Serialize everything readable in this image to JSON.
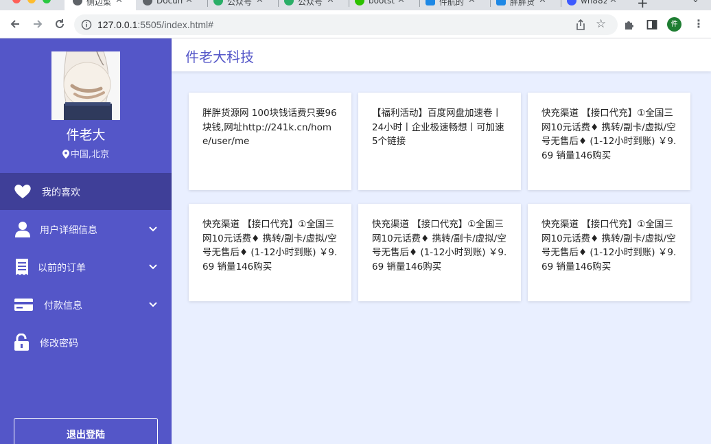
{
  "browser": {
    "tabs": [
      {
        "title": "侧边菜",
        "active": true,
        "favicon_color": "#5f6368"
      },
      {
        "title": "Docum",
        "active": false,
        "favicon_color": "#5f6368"
      },
      {
        "title": "公众号",
        "active": false,
        "favicon_color": "#2aae67"
      },
      {
        "title": "公众号",
        "active": false,
        "favicon_color": "#2aae67"
      },
      {
        "title": "bootst",
        "active": false,
        "favicon_color": "#2dc100"
      },
      {
        "title": "件航的",
        "active": false,
        "favicon_color": "#1e88e5"
      },
      {
        "title": "胖胖货",
        "active": false,
        "favicon_color": "#1e88e5"
      },
      {
        "title": "wh882",
        "active": false,
        "favicon_color": "#3d5afe"
      }
    ],
    "tab_close": "✕",
    "new_tab": "+",
    "url_host": "127.0.0.1",
    "url_rest": ":5505/index.html#",
    "profile_initial": "件"
  },
  "sidebar": {
    "user_name": "件老大",
    "location": "中国,北京",
    "menu": [
      {
        "label": "我的喜欢",
        "icon": "heart-icon",
        "active": true,
        "chevron": false
      },
      {
        "label": "用户详细信息",
        "icon": "user-icon",
        "active": false,
        "chevron": true
      },
      {
        "label": "以前的订单",
        "icon": "receipt-icon",
        "active": false,
        "chevron": true
      },
      {
        "label": "付款信息",
        "icon": "credit-card-icon",
        "active": false,
        "chevron": true
      },
      {
        "label": "修改密码",
        "icon": "unlock-icon",
        "active": false,
        "chevron": false
      }
    ],
    "logout_label": "退出登陆"
  },
  "header": {
    "brand": "件老大科技"
  },
  "cards": [
    {
      "text": "胖胖货源网 100块钱话费只要96块钱,网址http://241k.cn/home/user/me"
    },
    {
      "text": "【福利活动】百度网盘加速卷丨24小时丨企业极速畅想丨可加速5个链接"
    },
    {
      "text": "快充渠道 【接口代充】①全国三网10元话费♦ 携转/副卡/虚拟/空号无售后♦ (1-12小时到账) ￥9.69 销量146购买"
    },
    {
      "text": "快充渠道 【接口代充】①全国三网10元话费♦ 携转/副卡/虚拟/空号无售后♦ (1-12小时到账) ￥9.69 销量146购买"
    },
    {
      "text": "快充渠道 【接口代充】①全国三网10元话费♦ 携转/副卡/虚拟/空号无售后♦ (1-12小时到账) ￥9.69 销量146购买"
    },
    {
      "text": "快充渠道 【接口代充】①全国三网10元话费♦ 携转/副卡/虚拟/空号无售后♦ (1-12小时到账) ￥9.69 销量146购买"
    }
  ],
  "colors": {
    "sidebar_bg": "#5456c8",
    "sidebar_active": "#3f3f98",
    "page_bg": "#e9efff",
    "brand": "#5456c8"
  }
}
